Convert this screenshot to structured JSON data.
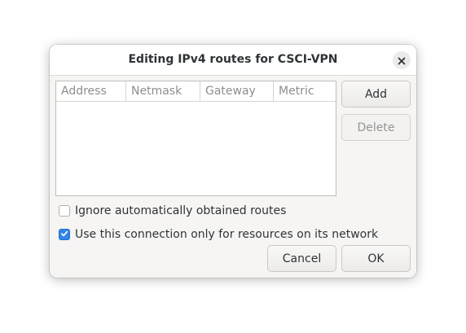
{
  "dialog": {
    "title": "Editing IPv4 routes for CSCI-VPN",
    "close_icon": "close-icon"
  },
  "table": {
    "columns": [
      "Address",
      "Netmask",
      "Gateway",
      "Metric"
    ],
    "rows": []
  },
  "buttons": {
    "add": "Add",
    "delete": "Delete",
    "cancel": "Cancel",
    "ok": "OK"
  },
  "options": {
    "ignore_auto_routes": {
      "label": "Ignore automatically obtained routes",
      "checked": false
    },
    "only_own_network": {
      "label": "Use this connection only for resources on its network",
      "checked": true
    }
  },
  "colors": {
    "accent": "#3584e4"
  }
}
